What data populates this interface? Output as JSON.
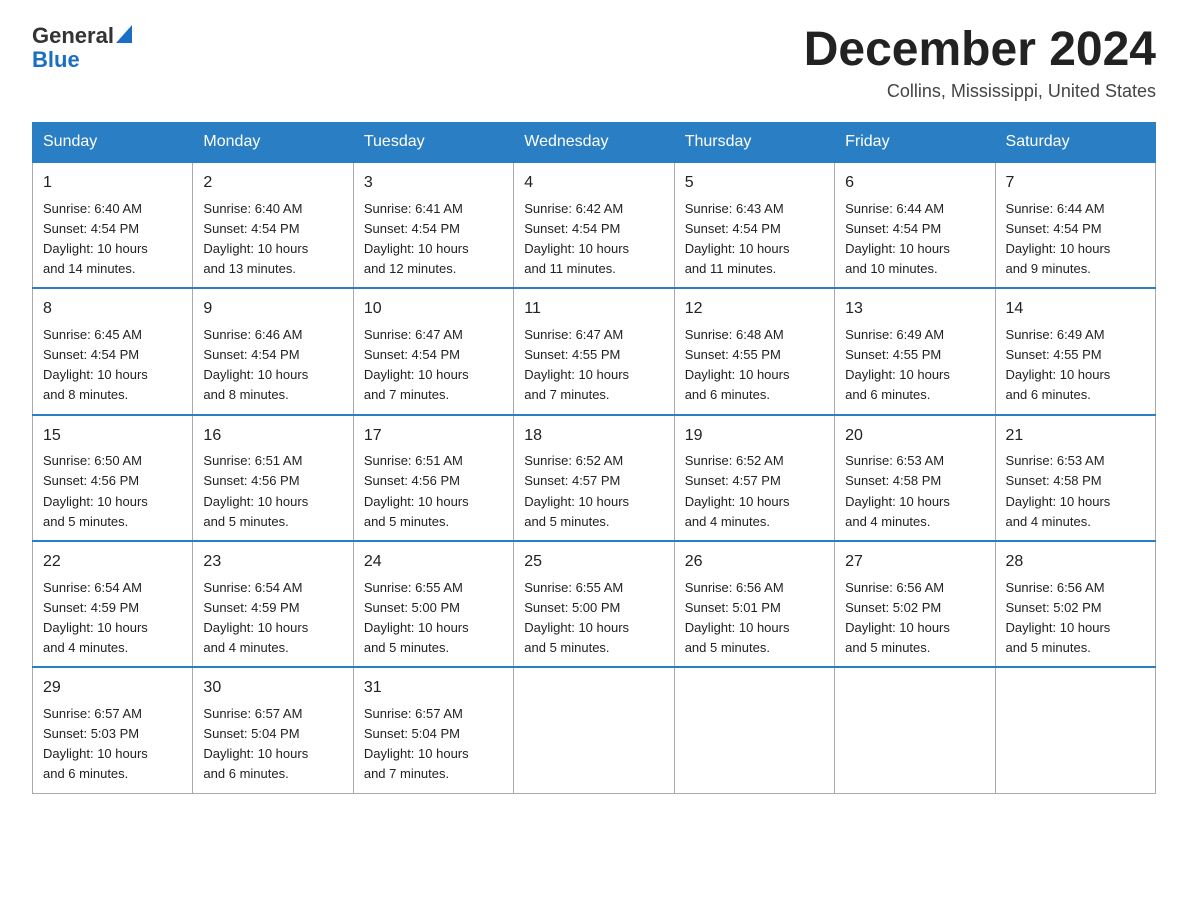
{
  "header": {
    "logo_general": "General",
    "logo_blue": "Blue",
    "month_year": "December 2024",
    "location": "Collins, Mississippi, United States"
  },
  "weekdays": [
    "Sunday",
    "Monday",
    "Tuesday",
    "Wednesday",
    "Thursday",
    "Friday",
    "Saturday"
  ],
  "weeks": [
    [
      {
        "day": "1",
        "sunrise": "6:40 AM",
        "sunset": "4:54 PM",
        "daylight": "10 hours and 14 minutes."
      },
      {
        "day": "2",
        "sunrise": "6:40 AM",
        "sunset": "4:54 PM",
        "daylight": "10 hours and 13 minutes."
      },
      {
        "day": "3",
        "sunrise": "6:41 AM",
        "sunset": "4:54 PM",
        "daylight": "10 hours and 12 minutes."
      },
      {
        "day": "4",
        "sunrise": "6:42 AM",
        "sunset": "4:54 PM",
        "daylight": "10 hours and 11 minutes."
      },
      {
        "day": "5",
        "sunrise": "6:43 AM",
        "sunset": "4:54 PM",
        "daylight": "10 hours and 11 minutes."
      },
      {
        "day": "6",
        "sunrise": "6:44 AM",
        "sunset": "4:54 PM",
        "daylight": "10 hours and 10 minutes."
      },
      {
        "day": "7",
        "sunrise": "6:44 AM",
        "sunset": "4:54 PM",
        "daylight": "10 hours and 9 minutes."
      }
    ],
    [
      {
        "day": "8",
        "sunrise": "6:45 AM",
        "sunset": "4:54 PM",
        "daylight": "10 hours and 8 minutes."
      },
      {
        "day": "9",
        "sunrise": "6:46 AM",
        "sunset": "4:54 PM",
        "daylight": "10 hours and 8 minutes."
      },
      {
        "day": "10",
        "sunrise": "6:47 AM",
        "sunset": "4:54 PM",
        "daylight": "10 hours and 7 minutes."
      },
      {
        "day": "11",
        "sunrise": "6:47 AM",
        "sunset": "4:55 PM",
        "daylight": "10 hours and 7 minutes."
      },
      {
        "day": "12",
        "sunrise": "6:48 AM",
        "sunset": "4:55 PM",
        "daylight": "10 hours and 6 minutes."
      },
      {
        "day": "13",
        "sunrise": "6:49 AM",
        "sunset": "4:55 PM",
        "daylight": "10 hours and 6 minutes."
      },
      {
        "day": "14",
        "sunrise": "6:49 AM",
        "sunset": "4:55 PM",
        "daylight": "10 hours and 6 minutes."
      }
    ],
    [
      {
        "day": "15",
        "sunrise": "6:50 AM",
        "sunset": "4:56 PM",
        "daylight": "10 hours and 5 minutes."
      },
      {
        "day": "16",
        "sunrise": "6:51 AM",
        "sunset": "4:56 PM",
        "daylight": "10 hours and 5 minutes."
      },
      {
        "day": "17",
        "sunrise": "6:51 AM",
        "sunset": "4:56 PM",
        "daylight": "10 hours and 5 minutes."
      },
      {
        "day": "18",
        "sunrise": "6:52 AM",
        "sunset": "4:57 PM",
        "daylight": "10 hours and 5 minutes."
      },
      {
        "day": "19",
        "sunrise": "6:52 AM",
        "sunset": "4:57 PM",
        "daylight": "10 hours and 4 minutes."
      },
      {
        "day": "20",
        "sunrise": "6:53 AM",
        "sunset": "4:58 PM",
        "daylight": "10 hours and 4 minutes."
      },
      {
        "day": "21",
        "sunrise": "6:53 AM",
        "sunset": "4:58 PM",
        "daylight": "10 hours and 4 minutes."
      }
    ],
    [
      {
        "day": "22",
        "sunrise": "6:54 AM",
        "sunset": "4:59 PM",
        "daylight": "10 hours and 4 minutes."
      },
      {
        "day": "23",
        "sunrise": "6:54 AM",
        "sunset": "4:59 PM",
        "daylight": "10 hours and 4 minutes."
      },
      {
        "day": "24",
        "sunrise": "6:55 AM",
        "sunset": "5:00 PM",
        "daylight": "10 hours and 5 minutes."
      },
      {
        "day": "25",
        "sunrise": "6:55 AM",
        "sunset": "5:00 PM",
        "daylight": "10 hours and 5 minutes."
      },
      {
        "day": "26",
        "sunrise": "6:56 AM",
        "sunset": "5:01 PM",
        "daylight": "10 hours and 5 minutes."
      },
      {
        "day": "27",
        "sunrise": "6:56 AM",
        "sunset": "5:02 PM",
        "daylight": "10 hours and 5 minutes."
      },
      {
        "day": "28",
        "sunrise": "6:56 AM",
        "sunset": "5:02 PM",
        "daylight": "10 hours and 5 minutes."
      }
    ],
    [
      {
        "day": "29",
        "sunrise": "6:57 AM",
        "sunset": "5:03 PM",
        "daylight": "10 hours and 6 minutes."
      },
      {
        "day": "30",
        "sunrise": "6:57 AM",
        "sunset": "5:04 PM",
        "daylight": "10 hours and 6 minutes."
      },
      {
        "day": "31",
        "sunrise": "6:57 AM",
        "sunset": "5:04 PM",
        "daylight": "10 hours and 7 minutes."
      },
      null,
      null,
      null,
      null
    ]
  ],
  "labels": {
    "sunrise": "Sunrise:",
    "sunset": "Sunset:",
    "daylight": "Daylight:"
  }
}
